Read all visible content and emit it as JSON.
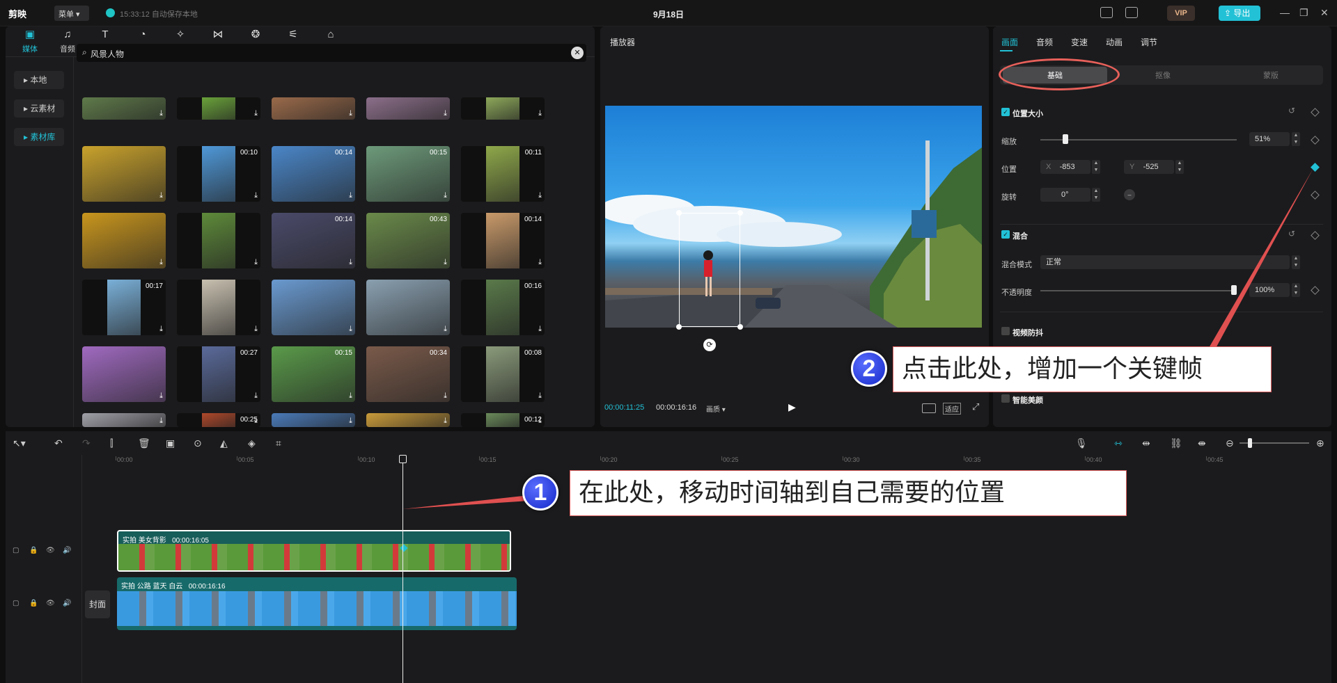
{
  "app": {
    "logo": "剪映",
    "menu_label": "菜单",
    "save_status": "15:33:12 自动保存本地",
    "project_title": "9月18日",
    "vip_label": "VIP",
    "export_label": "导出"
  },
  "media": {
    "tabs": [
      {
        "label": "媒体",
        "icon": "media-icon"
      },
      {
        "label": "音频",
        "icon": "audio-icon"
      },
      {
        "label": "文本",
        "icon": "text-icon"
      },
      {
        "label": "贴纸",
        "icon": "sticker-icon"
      },
      {
        "label": "特效",
        "icon": "effects-icon"
      },
      {
        "label": "转场",
        "icon": "transition-icon"
      },
      {
        "label": "滤镜",
        "icon": "filter-icon"
      },
      {
        "label": "调节",
        "icon": "adjust-icon"
      },
      {
        "label": "素材包",
        "icon": "package-icon"
      }
    ],
    "side_items": [
      "本地",
      "云素材",
      "素材库"
    ],
    "search_value": "风景人物",
    "thumbnails": [
      {
        "dur": "",
        "color": "#5f7a4a"
      },
      {
        "dur": "",
        "color": "#6aa23a"
      },
      {
        "dur": "",
        "color": "#9a6a4a"
      },
      {
        "dur": "",
        "color": "#8c6f8a"
      },
      {
        "dur": "",
        "color": "#8da85a"
      },
      {
        "dur": "",
        "color": "#c9a22c"
      },
      {
        "dur": "00:10",
        "color": "#4f98d8"
      },
      {
        "dur": "00:14",
        "color": "#4a86c8"
      },
      {
        "dur": "00:15",
        "color": "#6d9a7a"
      },
      {
        "dur": "00:11",
        "color": "#8fa84a"
      },
      {
        "dur": "",
        "color": "#c9961e"
      },
      {
        "dur": "",
        "color": "#5e8a3a"
      },
      {
        "dur": "00:14",
        "color": "#4a4a6a"
      },
      {
        "dur": "00:43",
        "color": "#6a8a4a"
      },
      {
        "dur": "00:14",
        "color": "#c99a6a"
      },
      {
        "dur": "00:17",
        "color": "#7ab0d8"
      },
      {
        "dur": "",
        "color": "#c8c0b0"
      },
      {
        "dur": "",
        "color": "#6a9ad0"
      },
      {
        "dur": "",
        "color": "#8aa0b0"
      },
      {
        "dur": "00:16",
        "color": "#5a7a4a"
      },
      {
        "dur": "",
        "color": "#a06ac0"
      },
      {
        "dur": "00:27",
        "color": "#5a6a9a"
      },
      {
        "dur": "00:15",
        "color": "#5a9a4a"
      },
      {
        "dur": "00:34",
        "color": "#7a5a4a"
      },
      {
        "dur": "00:08",
        "color": "#8a9a7a"
      },
      {
        "dur": "",
        "color": "#a0a0a8"
      },
      {
        "dur": "00:25",
        "color": "#b0482a"
      },
      {
        "dur": "",
        "color": "#4a7ab8"
      },
      {
        "dur": "",
        "color": "#c89a3a"
      },
      {
        "dur": "00:12",
        "color": "#6a8a5a"
      }
    ]
  },
  "player": {
    "title": "播放器",
    "current_time": "00:00:11:25",
    "total_time": "00:00:16:16",
    "quality": "画质",
    "fit_label": "适应"
  },
  "inspector": {
    "tabs": [
      "画面",
      "音频",
      "变速",
      "动画",
      "调节"
    ],
    "subtabs": [
      "基础",
      "抠像",
      "蒙版"
    ],
    "section_position": "位置大小",
    "scale_label": "缩放",
    "scale_value": "51%",
    "scale_fraction": 0.51,
    "position_label": "位置",
    "x_label": "X",
    "x_value": "-853",
    "y_label": "Y",
    "y_value": "-525",
    "rotate_label": "旋转",
    "rotate_value": "0°",
    "section_blend": "混合",
    "blend_mode_label": "混合模式",
    "blend_mode_value": "正常",
    "opacity_label": "不透明度",
    "opacity_value": "100%",
    "opacity_fraction": 1.0,
    "section_stabilize": "视频防抖",
    "section_beauty": "智能美颜"
  },
  "timeline": {
    "ruler": [
      "00:00",
      "00:05",
      "00:10",
      "00:15",
      "00:20",
      "00:25",
      "00:30",
      "00:35",
      "00:40",
      "00:45"
    ],
    "clip1": {
      "name": "实拍 美女背影",
      "duration": "00:00:16:05"
    },
    "clip2": {
      "name": "实拍 公路 蓝天 白云",
      "duration": "00:00:16:16"
    },
    "cover_label": "封面"
  },
  "callouts": {
    "c1_num": "1",
    "c1_text": "在此处，移动时间轴到自己需要的位置",
    "c2_num": "2",
    "c2_text": "点击此处，增加一个关键帧"
  },
  "colors": {
    "accent": "#22c1d6",
    "callout_border": "#e06060",
    "badge_blue": "#1428c8"
  }
}
